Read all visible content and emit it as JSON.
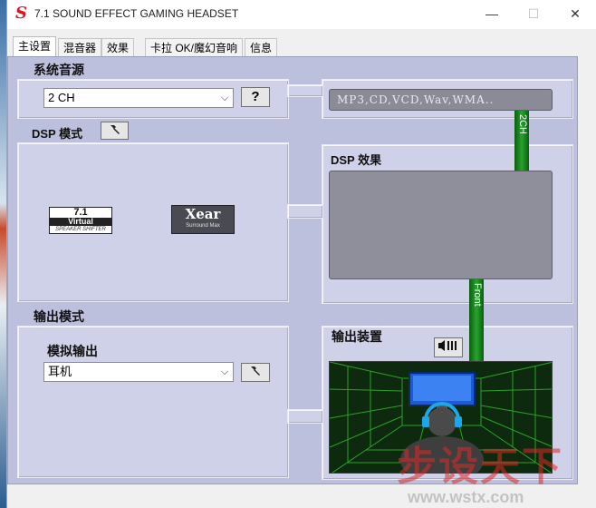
{
  "window": {
    "title": "7.1 SOUND EFFECT GAMING HEADSET",
    "logo_letter": "S"
  },
  "window_controls": {
    "minimize": "—",
    "maximize": "☐",
    "close": "✕"
  },
  "tabs": [
    {
      "label": "主设置",
      "active": true
    },
    {
      "label": "混音器",
      "active": false
    },
    {
      "label": "效果",
      "active": false
    },
    {
      "label": "卡拉 OK/魔幻音响",
      "active": false
    },
    {
      "label": "信息",
      "active": false
    }
  ],
  "system_source": {
    "label": "系统音源",
    "selected": "2 CH",
    "help_label": "?",
    "format_display": "MP3,CD,VCD,Wav,WMA.."
  },
  "dsp_mode": {
    "label": "DSP 模式",
    "badge_71": {
      "top": "7.1",
      "mid": "Virtual",
      "sub": "SPEAKER SHIFTER"
    },
    "badge_xear": {
      "top": "Xear",
      "sub": "Surround Max"
    }
  },
  "dsp_effect": {
    "label": "DSP 效果",
    "link_label": "2CH"
  },
  "output_mode": {
    "label": "输出模式",
    "sub_label": "模拟输出",
    "selected": "耳机"
  },
  "output_device": {
    "label": "输出装置",
    "link_label": "Front"
  },
  "watermark": {
    "text": "步设天下",
    "url": "www.wstx.com"
  },
  "colors": {
    "panel": "#bcc0dd",
    "shelf": "#cfd1e8",
    "link_green": "#27a32c",
    "brand_red": "#d9161c"
  }
}
